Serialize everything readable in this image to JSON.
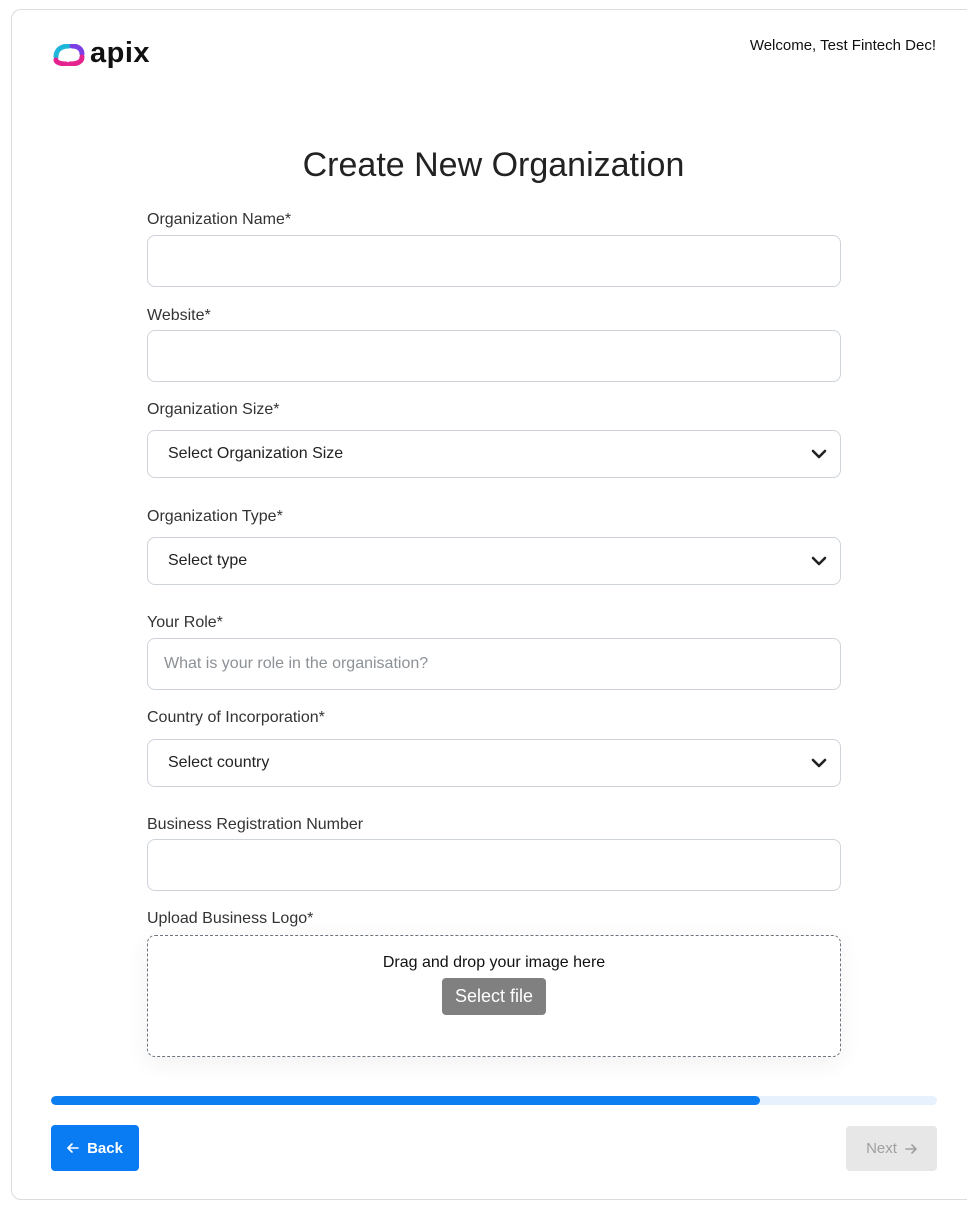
{
  "header": {
    "logo_text": "apix",
    "welcome": "Welcome, Test Fintech Dec!"
  },
  "page_title": "Create New Organization",
  "form": {
    "org_name": {
      "label": "Organization Name*",
      "value": "",
      "placeholder": ""
    },
    "website": {
      "label": "Website*",
      "value": "",
      "placeholder": ""
    },
    "org_size": {
      "label": "Organization Size*",
      "selected": "Select Organization Size"
    },
    "org_type": {
      "label": "Organization Type*",
      "selected": "Select type"
    },
    "role": {
      "label": "Your Role*",
      "value": "",
      "placeholder": "What is your role in the organisation?"
    },
    "country": {
      "label": "Country of Incorporation*",
      "selected": "Select country"
    },
    "brn": {
      "label": "Business Registration Number",
      "value": "",
      "placeholder": ""
    },
    "logo_upload": {
      "label": "Upload Business Logo*",
      "drop_text": "Drag and drop your image here",
      "button": "Select file"
    }
  },
  "progress": {
    "percent": 80
  },
  "nav": {
    "back_label": "Back",
    "next_label": "Next"
  },
  "colors": {
    "primary": "#0a7cf3",
    "progress_track": "#e7f1fd",
    "disabled_bg": "#e7e7e7",
    "logo_pink": "#e4238f",
    "logo_purple": "#7b3fe4",
    "logo_teal": "#1fb6d9"
  },
  "icons": {
    "dropdown": "chevron-down-icon",
    "back": "arrow-left-icon",
    "next": "arrow-right-icon",
    "logo": "apix-logo-icon"
  }
}
